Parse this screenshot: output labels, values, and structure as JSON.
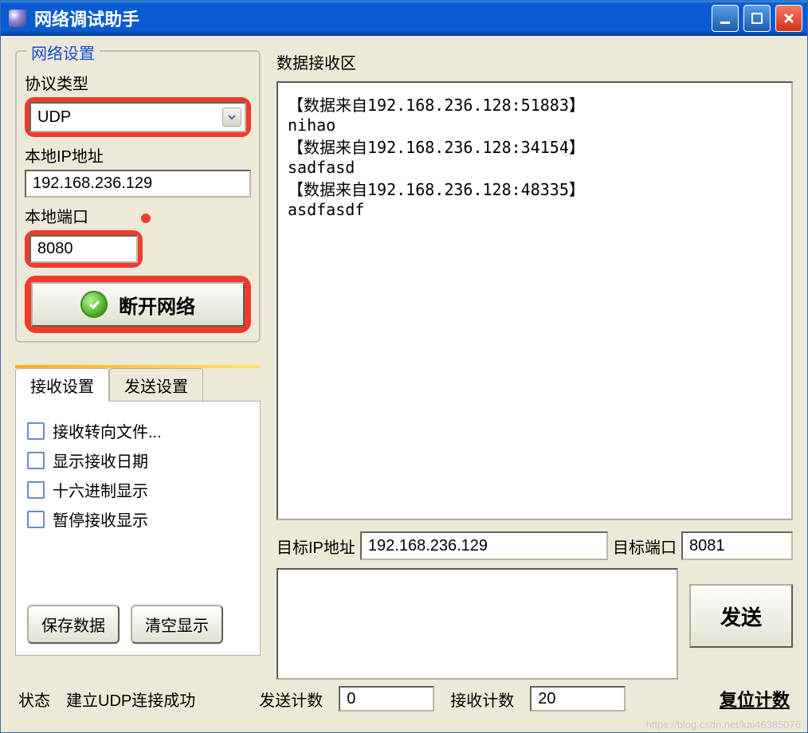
{
  "window": {
    "title": "网络调试助手"
  },
  "network_settings": {
    "legend": "网络设置",
    "protocol_label": "协议类型",
    "protocol_value": "UDP",
    "local_ip_label": "本地IP地址",
    "local_ip_value": "192.168.236.129",
    "local_port_label": "本地端口",
    "local_port_value": "8080",
    "disconnect_label": "断开网络"
  },
  "tabs": {
    "recv_settings": "接收设置",
    "send_settings": "发送设置"
  },
  "recv_options": {
    "redirect_file": "接收转向文件...",
    "show_date": "显示接收日期",
    "hex_display": "十六进制显示",
    "pause_display": "暂停接收显示",
    "save_data": "保存数据",
    "clear_display": "清空显示"
  },
  "recv_area": {
    "label": "数据接收区",
    "content": "【数据来自192.168.236.128:51883】\nnihao\n【数据来自192.168.236.128:34154】\nsadfasd\n【数据来自192.168.236.128:48335】\nasdfasdf"
  },
  "target": {
    "ip_label": "目标IP地址",
    "ip_value": "192.168.236.129",
    "port_label": "目标端口",
    "port_value": "8081"
  },
  "send": {
    "button": "发送",
    "text": ""
  },
  "status": {
    "label": "状态",
    "text": "建立UDP连接成功",
    "send_count_label": "发送计数",
    "send_count_value": "0",
    "recv_count_label": "接收计数",
    "recv_count_value": "20",
    "reset": "复位计数"
  },
  "watermark": "https://blog.csdn.net/kai46385076"
}
